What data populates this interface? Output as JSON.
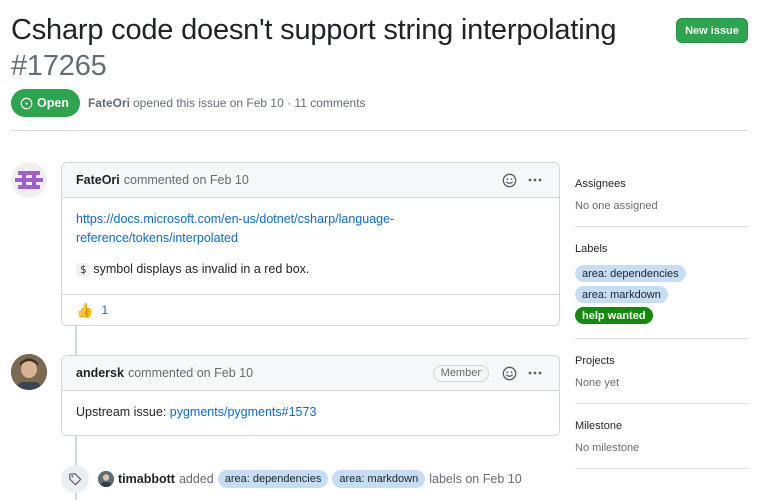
{
  "issue": {
    "title": "Csharp code doesn't support string interpolating",
    "number": "#17265",
    "state": "Open",
    "author": "FateOri",
    "meta": "opened this issue on Feb 10 · 11 comments"
  },
  "header": {
    "new_issue_label": "New issue"
  },
  "comments": [
    {
      "author": "FateOri",
      "meta": "commented on Feb 10",
      "link_line1": "https://docs.microsoft.com/en-us/dotnet/csharp/language-",
      "link_line2": "reference/tokens/interpolated",
      "code": "$",
      "text": "symbol displays as invalid in a red box.",
      "reaction_emoji": "👍",
      "reaction_count": "1"
    },
    {
      "author": "andersk",
      "meta": "commented on Feb 10",
      "role_badge": "Member",
      "text_prefix": "Upstream issue: ",
      "link": "pygments/pygments#1573"
    }
  ],
  "event": {
    "actor": "timabbott",
    "verb": "added",
    "labels": [
      "area: dependencies",
      "area: markdown"
    ],
    "suffix": "labels on Feb 10"
  },
  "sidebar": {
    "assignees": {
      "title": "Assignees",
      "value": "No one assigned"
    },
    "labels": {
      "title": "Labels",
      "items": [
        "area: dependencies",
        "area: markdown",
        "help wanted"
      ]
    },
    "projects": {
      "title": "Projects",
      "value": "None yet"
    },
    "milestone": {
      "title": "Milestone",
      "value": "No milestone"
    }
  },
  "icons": {
    "smiley": "smiley-icon",
    "kebab": "kebab-horizontal-icon",
    "issue_opened": "issue-opened-icon",
    "tag": "tag-icon"
  },
  "colors": {
    "open_green": "#2da44e",
    "link_blue": "#0969da",
    "label_area": "#c5def5",
    "label_help": "#128a0c"
  }
}
